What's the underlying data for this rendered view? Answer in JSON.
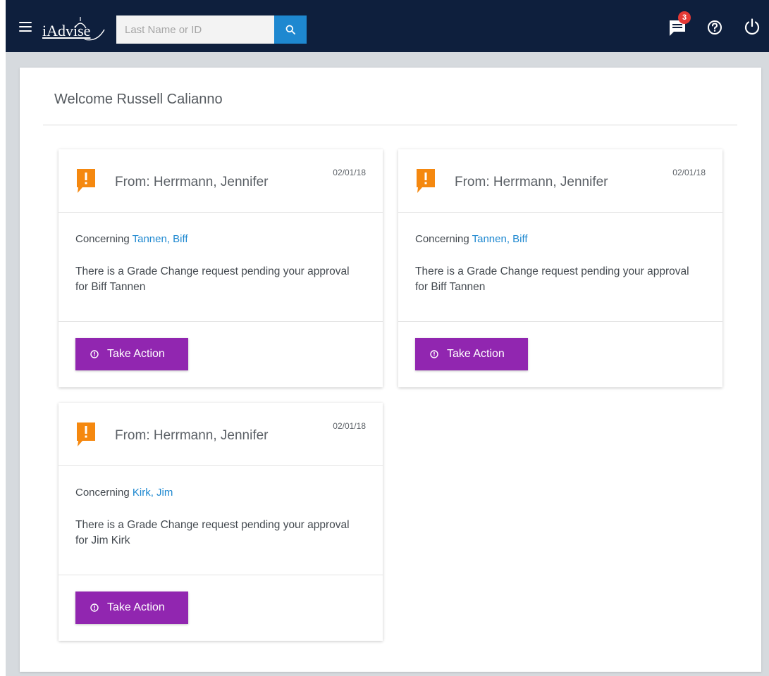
{
  "header": {
    "logo_text": "iAdvise",
    "search": {
      "placeholder": "Last Name or ID",
      "value": ""
    },
    "messages_badge": "3",
    "icons": [
      "menu-icon",
      "search-icon",
      "messages-icon",
      "help-icon",
      "power-icon"
    ]
  },
  "welcome": "Welcome Russell Calianno",
  "colors": {
    "nav": "#0e1f3d",
    "search_button": "#1e88d0",
    "action_button": "#9126b0",
    "alert_icon": "#f5880f",
    "link": "#1e88d0",
    "badge": "#e53935"
  },
  "notifications": [
    {
      "from": "From: Herrmann, Jennifer",
      "date": "02/01/18",
      "concerning_label": "Concerning",
      "concerning_name": "Tannen, Biff",
      "message": "There is a Grade Change request pending your approval for Biff Tannen",
      "action_label": "Take Action"
    },
    {
      "from": "From: Herrmann, Jennifer",
      "date": "02/01/18",
      "concerning_label": "Concerning",
      "concerning_name": "Tannen, Biff",
      "message": "There is a Grade Change request pending your approval for Biff Tannen",
      "action_label": "Take Action"
    },
    {
      "from": "From: Herrmann, Jennifer",
      "date": "02/01/18",
      "concerning_label": "Concerning",
      "concerning_name": "Kirk, Jim",
      "message": "There is a Grade Change request pending your approval for Jim Kirk",
      "action_label": "Take Action"
    }
  ]
}
